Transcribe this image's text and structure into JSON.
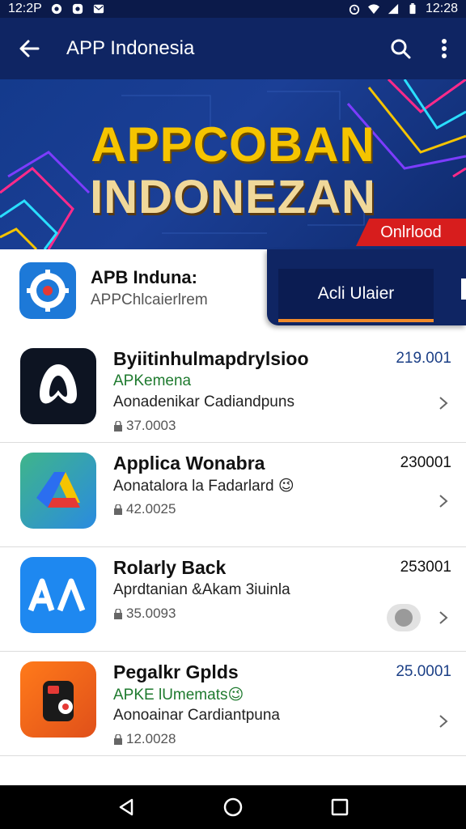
{
  "status_bar": {
    "left_time": "12:2P",
    "right_time": "12:28",
    "icons": [
      "circle-dot-icon",
      "app-notification-icon",
      "mail-icon",
      "alarm-icon",
      "wifi-icon",
      "signal-icon",
      "battery-icon"
    ]
  },
  "app_bar": {
    "title": "APP Indonesia",
    "back_icon": "arrow-left-icon",
    "search_icon": "search-icon",
    "menu_icon": "more-vertical-icon"
  },
  "banner": {
    "line1": "APPCOBAN",
    "line2": "INDONEZAN",
    "badge": "Onlrlood",
    "colors": {
      "title": "#f5c400",
      "badge": "#d71d1d",
      "background": "#143a8c"
    }
  },
  "featured": {
    "name": "APB Induna:",
    "subtitle": "APPChlcaierlrem",
    "button_label": "Acli Ulaier",
    "accent": "#f08a2a"
  },
  "apps": [
    {
      "name": "Byiitinhulmapdrylsioo",
      "tag": "APKemena",
      "desc": "Aonadenikar Cadiandpuns",
      "size": "37.0003",
      "count": "219.001",
      "icon": "loop-logo-icon"
    },
    {
      "name": "Applica Wonabra",
      "tag": "",
      "desc": "Aonatalora la Fadarlard 😉",
      "size": "42.0025",
      "count": "230001",
      "icon": "drive-triangle-icon"
    },
    {
      "name": "Rolarly Back",
      "tag": "",
      "desc": "Aprdtanian &Akam 3iuinla",
      "size": "35.0093",
      "count": "253001",
      "icon": "aa-logo-icon"
    },
    {
      "name": "Pegalkr Gplds",
      "tag": "APKE lUmemats😉",
      "desc": "Aonoainar Cardiantpuna",
      "size": "12.0028",
      "count": "25.0001",
      "icon": "phone-app-icon"
    }
  ],
  "nav_bar": {
    "icons": [
      "back-triangle-icon",
      "home-circle-icon",
      "recents-square-icon"
    ]
  }
}
